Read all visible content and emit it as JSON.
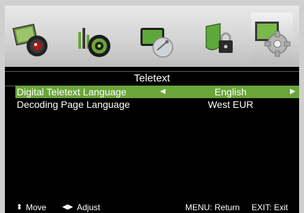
{
  "menu": {
    "icons": [
      {
        "name": "picture-icon",
        "active": false
      },
      {
        "name": "sound-icon",
        "active": false
      },
      {
        "name": "channel-icon",
        "active": false
      },
      {
        "name": "lock-icon",
        "active": false
      },
      {
        "name": "setup-gear-icon",
        "active": true
      }
    ]
  },
  "page": {
    "title": "Teletext"
  },
  "settings": [
    {
      "label": "Digital Teletext Language",
      "value": "English",
      "selected": true
    },
    {
      "label": "Decoding Page Language",
      "value": "West EUR",
      "selected": false
    }
  ],
  "footer": {
    "move_label": "Move",
    "adjust_label": "Adjust",
    "return_label": "MENU: Return",
    "exit_label": "EXIT: Exit"
  },
  "colors": {
    "selection": "#6aa53a",
    "background": "#000000"
  }
}
